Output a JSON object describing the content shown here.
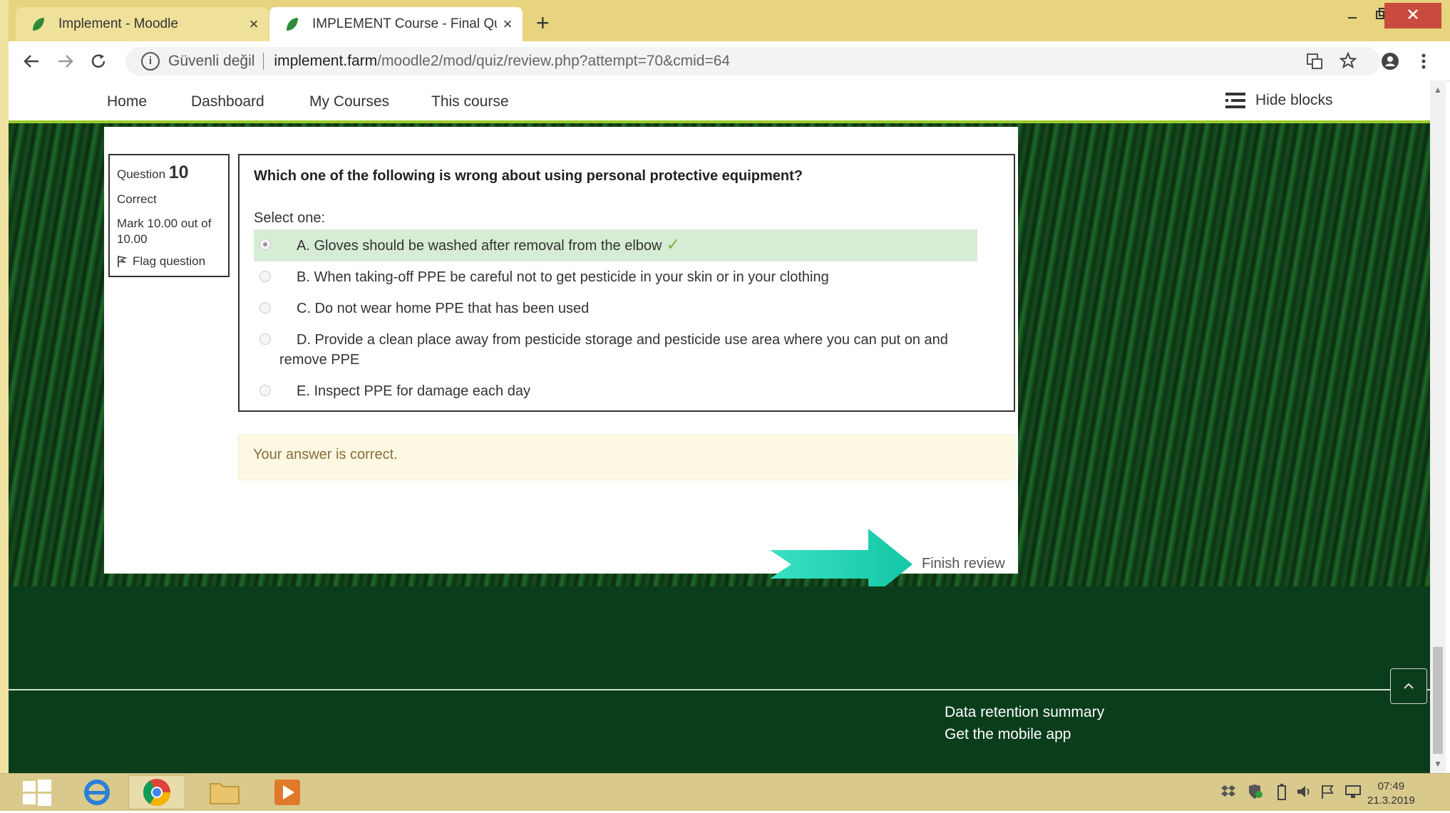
{
  "browser": {
    "tabs": [
      {
        "title": "Implement - Moodle",
        "close": "×"
      },
      {
        "title": "IMPLEMENT Course - Final Quest",
        "close": "×"
      }
    ],
    "new_tab": "+",
    "address": {
      "security_label": "Güvenli değil",
      "host": "implement.farm",
      "path": "/moodle2/mod/quiz/review.php?attempt=70&cmid=64"
    }
  },
  "nav": {
    "items": [
      "Home",
      "Dashboard",
      "My Courses",
      "This course"
    ],
    "hide_blocks": "Hide blocks"
  },
  "question_info": {
    "label": "Question",
    "number": "10",
    "state": "Correct",
    "mark": "Mark 10.00 out of 10.00",
    "flag": "Flag question"
  },
  "question": {
    "text": "Which one of the following is wrong about using personal protective equipment?",
    "prompt": "Select one:",
    "answers": [
      "A. Gloves should be washed after removal from the elbow",
      "B. When taking-off PPE be careful not to get pesticide in your skin or in your clothing",
      "C. Do not wear home PPE that has been used",
      "D. Provide a clean place away from pesticide storage and pesticide use area where you can put on and remove PPE",
      "E. Inspect PPE for damage each day"
    ]
  },
  "feedback": "Your answer is correct.",
  "finish_review": "Finish review",
  "footer": {
    "links": [
      "Data retention summary",
      "Get the mobile app"
    ]
  },
  "taskbar": {
    "time": "07:49",
    "date": "21.3.2019"
  },
  "colors": {
    "accent": "#9ccc2c",
    "correct_bg": "#d7ecd4",
    "feedback_bg": "#fcf8e3",
    "arrow": "#22d6b4"
  }
}
